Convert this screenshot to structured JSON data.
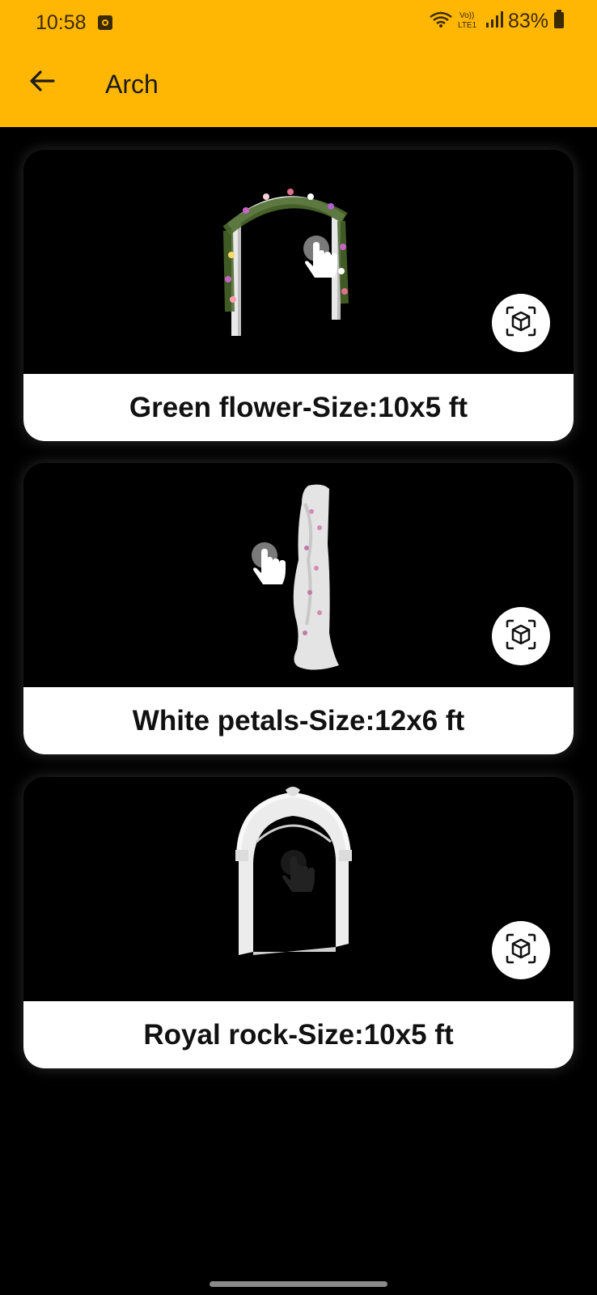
{
  "status_bar": {
    "time": "10:58",
    "battery": "83%",
    "icons": [
      "screen-record-icon",
      "wifi-icon",
      "volte-icon",
      "signal-icon",
      "battery-icon"
    ],
    "volte_text": "Vo))\nLTE1"
  },
  "app_bar": {
    "title": "Arch",
    "back_icon": "arrow-left-icon",
    "background": "#FFB703"
  },
  "items": [
    {
      "label": "Green flower-Size:10x5 ft",
      "model": "green-flower-arch",
      "ar_icon": "ar-cube-icon"
    },
    {
      "label": "White petals-Size:12x6 ft",
      "model": "white-petals-pillar",
      "ar_icon": "ar-cube-icon"
    },
    {
      "label": "Royal rock-Size:10x5 ft",
      "model": "royal-rock-arch",
      "ar_icon": "ar-cube-icon"
    }
  ],
  "colors": {
    "accent": "#FFB703",
    "background": "#000000",
    "card_label_bg": "#FFFFFF"
  }
}
